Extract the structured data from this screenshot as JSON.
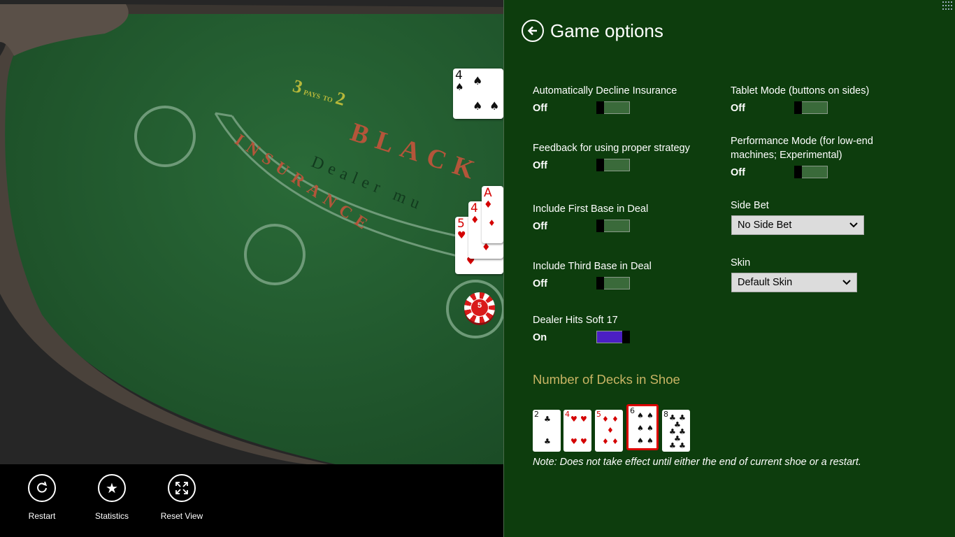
{
  "table": {
    "payout_number_left": "3",
    "payout_pays": "PAYS",
    "payout_to": "TO",
    "payout_number_right": "2",
    "blackjack_text": "BLACK",
    "insurance_text": "INSURANCE",
    "dealer_text": "Dealer mu",
    "chip_value": "5",
    "dealer_card": {
      "rank": "4",
      "suit": "♠"
    },
    "player_cards": [
      {
        "rank": "5",
        "suit": "♥"
      },
      {
        "rank": "4",
        "suit": "♦"
      },
      {
        "rank": "A",
        "suit": "♦"
      }
    ]
  },
  "app_bar": {
    "restart_label": "Restart",
    "statistics_label": "Statistics",
    "reset_view_label": "Reset View"
  },
  "panel": {
    "title": "Game options",
    "options": {
      "auto_decline_insurance": {
        "label": "Automatically Decline Insurance",
        "state": "Off"
      },
      "feedback_strategy": {
        "label": "Feedback for using proper strategy",
        "state": "Off"
      },
      "include_first_base": {
        "label": "Include First Base in Deal",
        "state": "Off"
      },
      "include_third_base": {
        "label": "Include Third Base in Deal",
        "state": "Off"
      },
      "dealer_hits_soft_17": {
        "label": "Dealer Hits Soft 17",
        "state": "On"
      },
      "tablet_mode": {
        "label": "Tablet Mode (buttons on sides)",
        "state": "Off"
      },
      "performance_mode": {
        "label": "Performance Mode (for low-end machines; Experimental)",
        "state": "Off"
      }
    },
    "side_bet": {
      "label": "Side Bet",
      "value": "No Side Bet"
    },
    "skin": {
      "label": "Skin",
      "value": "Default Skin"
    },
    "decks_heading": "Number of Decks in Shoe",
    "deck_choices": [
      {
        "rank": "2",
        "suit": "♣",
        "selected": false
      },
      {
        "rank": "4",
        "suit": "♥",
        "selected": false
      },
      {
        "rank": "5",
        "suit": "♦",
        "selected": false
      },
      {
        "rank": "6",
        "suit": "♠",
        "selected": true
      },
      {
        "rank": "8",
        "suit": "♣",
        "selected": false
      }
    ],
    "note": "Note: Does not take effect until either the end of current shoe or a restart."
  },
  "colors": {
    "felt": "#215a2f",
    "panel_bg": "#0d3d0d",
    "toggle_on": "#4b1fc4",
    "heading_gold": "#c8b464",
    "selected_border": "#dd0000"
  }
}
